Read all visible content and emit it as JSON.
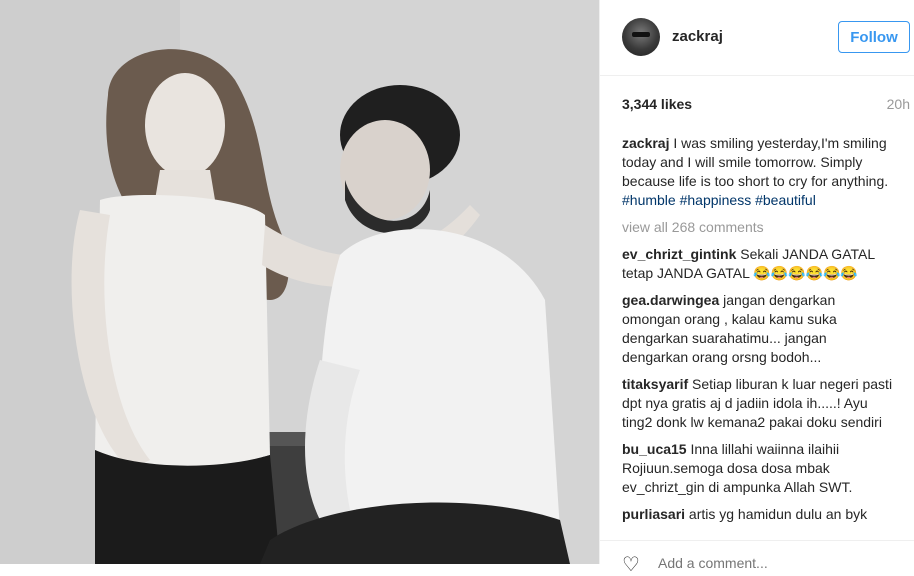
{
  "post": {
    "username": "zackraj",
    "follow_label": "Follow",
    "likes": "3,344 likes",
    "time": "20h",
    "caption": {
      "user": "zackraj",
      "text": "I was smiling yesterday,I'm smiling today and I will smile tomorrow. Simply because life is too short to cry for anything.",
      "hashtags": [
        "#humble",
        "#happiness",
        "#beautiful"
      ]
    },
    "view_all": "view all 268 comments",
    "comments": [
      {
        "user": "ev_chrizt_gintink",
        "text": "Sekali JANDA GATAL tetap JANDA GATAL 😂😂😂😂😂😂"
      },
      {
        "user": "gea.darwingea",
        "text": "jangan dengarkan omongan orang , kalau kamu suka dengarkan suarahatimu... jangan dengarkan orang orsng bodoh..."
      },
      {
        "user": "titaksyarif",
        "text": "Setiap liburan k luar negeri pasti dpt nya gratis aj d jadiin idola ih.....! Ayu ting2 donk lw kemana2 pakai doku sendiri"
      },
      {
        "user": "bu_uca15",
        "text": "Inna lillahi waiinna ilaihii Rojiuun.semoga dosa dosa mbak ev_chrizt_gin di ampunka Allah SWT."
      },
      {
        "user": "purliasari",
        "text": "artis yg hamidun dulu an byk"
      }
    ],
    "add_comment_placeholder": "Add a comment..."
  },
  "icons": {
    "like": "heart-icon",
    "avatar": "avatar"
  }
}
